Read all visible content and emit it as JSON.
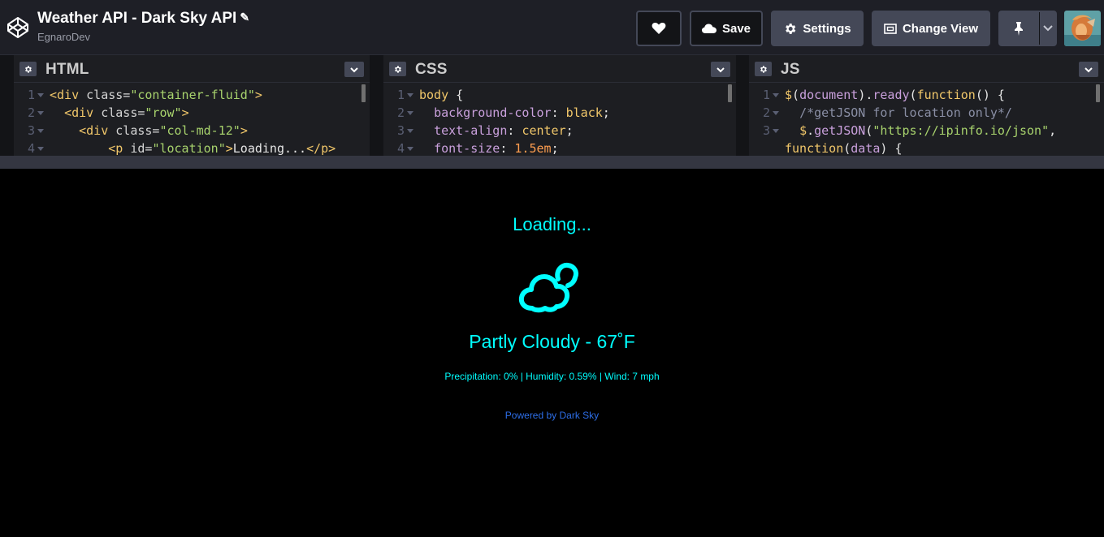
{
  "header": {
    "title": "Weather API - Dark Sky API",
    "author": "EgnaroDev",
    "buttons": {
      "save": "Save",
      "settings": "Settings",
      "change_view": "Change View"
    }
  },
  "editors": [
    {
      "name": "HTML",
      "lines": [
        {
          "num": "1",
          "html": "<span class='t-tag'>&lt;div</span> <span class='t-attr'>class=</span><span class='t-str'>\"container-fluid\"</span><span class='t-tag'>&gt;</span>"
        },
        {
          "num": "2",
          "html": "  <span class='t-tag'>&lt;div</span> <span class='t-attr'>class=</span><span class='t-str'>\"row\"</span><span class='t-tag'>&gt;</span>"
        },
        {
          "num": "3",
          "html": "    <span class='t-tag'>&lt;div</span> <span class='t-attr'>class=</span><span class='t-str'>\"col-md-12\"</span><span class='t-tag'>&gt;</span>"
        },
        {
          "num": "4",
          "html": "        <span class='t-tag'>&lt;p</span> <span class='t-attr'>id=</span><span class='t-str'>\"location\"</span><span class='t-tag'>&gt;</span><span class='t-plain'>Loading...</span><span class='t-tag'>&lt;/p&gt;</span>"
        }
      ]
    },
    {
      "name": "CSS",
      "lines": [
        {
          "num": "1",
          "html": "<span class='t-sel'>body</span> <span class='t-plain'>{</span>"
        },
        {
          "num": "2",
          "html": "  <span class='t-prop'>background-color</span><span class='t-plain'>:</span> <span class='t-val'>black</span><span class='t-plain'>;</span>"
        },
        {
          "num": "3",
          "html": "  <span class='t-prop'>text-align</span><span class='t-plain'>:</span> <span class='t-val'>center</span><span class='t-plain'>;</span>"
        },
        {
          "num": "4",
          "html": "  <span class='t-prop'>font-size</span><span class='t-plain'>:</span> <span class='t-num'>1.5em</span><span class='t-plain'>;</span>"
        }
      ]
    },
    {
      "name": "JS",
      "lines": [
        {
          "num": "1",
          "html": "<span class='t-fn'>$</span><span class='t-plain'>(</span><span class='t-id'>document</span><span class='t-plain'>).</span><span class='t-id'>ready</span><span class='t-plain'>(</span><span class='t-fn'>function</span><span class='t-plain'>() {</span>"
        },
        {
          "num": "2",
          "html": "  <span class='t-com'>/*getJSON for location only*/</span>"
        },
        {
          "num": "3",
          "html": "  <span class='t-fn'>$</span><span class='t-plain'>.</span><span class='t-id'>getJSON</span><span class='t-plain'>(</span><span class='t-str'>\"https://ipinfo.io/json\"</span><span class='t-plain'>,</span>"
        },
        {
          "num": "",
          "html": "<span class='t-fn'>function</span><span class='t-plain'>(</span><span class='t-id'>data</span><span class='t-plain'>) {</span>"
        }
      ]
    }
  ],
  "preview": {
    "location": "Loading...",
    "summary": "Partly Cloudy - 67˚F",
    "details": "Precipitation: 0% | Humidity: 0.59% | Wind: 7 mph",
    "powered_by": "Powered by Dark Sky",
    "accent_color": "#00ffff",
    "link_color": "#2d6ee8"
  }
}
